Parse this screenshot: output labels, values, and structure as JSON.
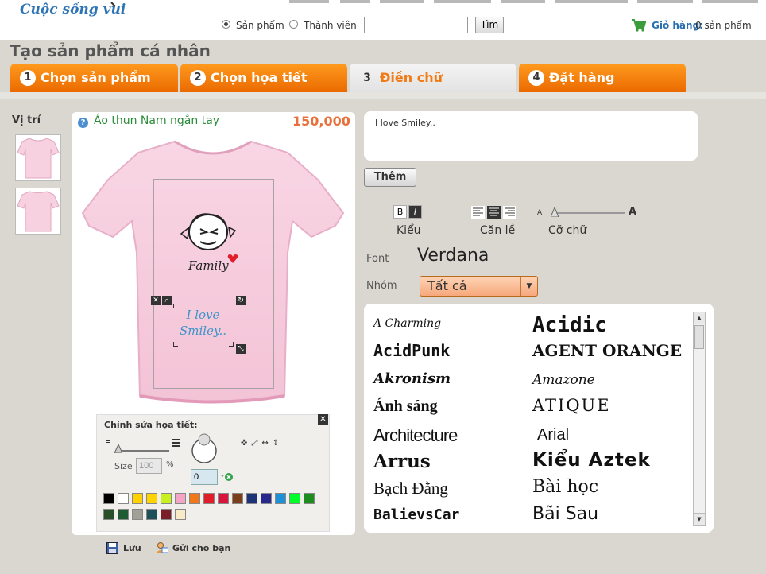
{
  "header": {
    "logo": "Cuộc sống vui",
    "search_options": [
      {
        "label": "Sản phẩm",
        "selected": true
      },
      {
        "label": "Thành viên",
        "selected": false
      }
    ],
    "search_value": "",
    "search_button": "Tìm",
    "cart_label": "Giỏ hàng:",
    "cart_count": "0 sản phẩm"
  },
  "page": {
    "title": "Tạo sản phẩm cá nhân",
    "steps": [
      {
        "num": "1",
        "label": "Chọn sản phẩm",
        "active": false
      },
      {
        "num": "2",
        "label": "Chọn họa tiết",
        "active": false
      },
      {
        "num": "3",
        "label": "Điền chữ",
        "active": true
      },
      {
        "num": "4",
        "label": "Đặt hàng",
        "active": false
      }
    ]
  },
  "position": {
    "label": "Vị trí"
  },
  "product": {
    "name": "Áo thun Nam ngắn tay",
    "price": "150,000",
    "tshirt_color": "#f7d1e0",
    "design_text": "Family",
    "custom_text_lines": [
      "I love",
      "Smiley.."
    ]
  },
  "edit_panel": {
    "title": "Chỉnh sửa họa tiết:",
    "size_label": "Size",
    "size_value": "100",
    "size_unit": "%",
    "rotate_value": "0",
    "colors_row1": [
      "#000000",
      "#ffffff",
      "#ffd100",
      "#ffd400",
      "#c8f01e",
      "#f4a4c4",
      "#f07818",
      "#e01e28",
      "#d8143c",
      "#7a3e1a",
      "#1e3278",
      "#28288c",
      "#1e90d8",
      "#00ff28",
      "#1e8c1e"
    ],
    "colors_row2": [
      "#285028",
      "#1e5a32",
      "#a0a096",
      "#1e505a",
      "#7a1e28",
      "#faebc8"
    ]
  },
  "text_editor": {
    "value": "I love Smiley..",
    "add_button": "Thêm",
    "bold": "B",
    "italic": "I",
    "style_label": "Kiểu",
    "align_label": "Căn lề",
    "size_label": "Cỡ chữ",
    "size_small": "A",
    "size_large": "A",
    "font_label": "Font",
    "font_value": "Verdana",
    "group_label": "Nhóm",
    "group_value": "Tất cả"
  },
  "fonts": {
    "left": [
      "A Charming",
      "AcidPunk",
      "Akronism",
      "Ánh sáng",
      "Architecture",
      "Arrus",
      "Bạch Đằng",
      "BalievsCar"
    ],
    "right": [
      "Acidic",
      "AGENT ORANGE",
      "Amazone",
      "ATIQUE",
      "Arial",
      "Kiểu Aztek",
      "Bài học",
      "Bãi Sau"
    ]
  },
  "footer": {
    "save": "Lưu",
    "send": "Gửi cho bạn"
  }
}
